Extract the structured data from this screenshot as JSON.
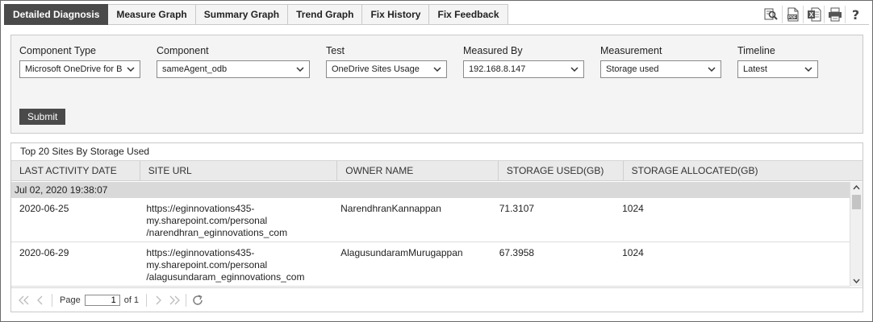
{
  "tabs": [
    {
      "label": "Detailed Diagnosis",
      "active": true
    },
    {
      "label": "Measure Graph",
      "active": false
    },
    {
      "label": "Summary Graph",
      "active": false
    },
    {
      "label": "Trend Graph",
      "active": false
    },
    {
      "label": "Fix History",
      "active": false
    },
    {
      "label": "Fix Feedback",
      "active": false
    }
  ],
  "toolbar": {
    "pdf_label": "PDF",
    "excel_label": "X",
    "help_label": "?"
  },
  "filters": {
    "component_type": {
      "label": "Component Type",
      "value": "Microsoft OneDrive for B"
    },
    "component": {
      "label": "Component",
      "value": "sameAgent_odb"
    },
    "test": {
      "label": "Test",
      "value": "OneDrive Sites Usage"
    },
    "measured_by": {
      "label": "Measured By",
      "value": "192.168.8.147"
    },
    "measurement": {
      "label": "Measurement",
      "value": "Storage used"
    },
    "timeline": {
      "label": "Timeline",
      "value": "Latest"
    },
    "submit_label": "Submit"
  },
  "grid": {
    "title": "Top 20 Sites By Storage Used",
    "columns": [
      "LAST ACTIVITY DATE",
      "SITE URL",
      "OWNER NAME",
      "STORAGE USED(GB)",
      "STORAGE ALLOCATED(GB)"
    ],
    "group_label": "Jul 02, 2020 19:38:07",
    "rows": [
      {
        "date": "2020-06-25",
        "url_lines": [
          "https://eginnovations435-",
          "my.sharepoint.com/personal",
          "/narendhran_eginnovations_com"
        ],
        "owner": "NarendhranKannappan",
        "used": "71.3107",
        "allocated": "1024"
      },
      {
        "date": "2020-06-29",
        "url_lines": [
          "https://eginnovations435-",
          "my.sharepoint.com/personal",
          "/alagusundaram_eginnovations_com"
        ],
        "owner": "AlagusundaramMurugappan",
        "used": "67.3958",
        "allocated": "1024"
      }
    ]
  },
  "pager": {
    "page_label": "Page",
    "current_page": "1",
    "of_label": "of 1"
  },
  "colors": {
    "active_tab": "#4a4a4a",
    "panel_bg": "#f4f4f4",
    "group_row": "#d9d9d9",
    "header_bg": "#eaeaea"
  }
}
